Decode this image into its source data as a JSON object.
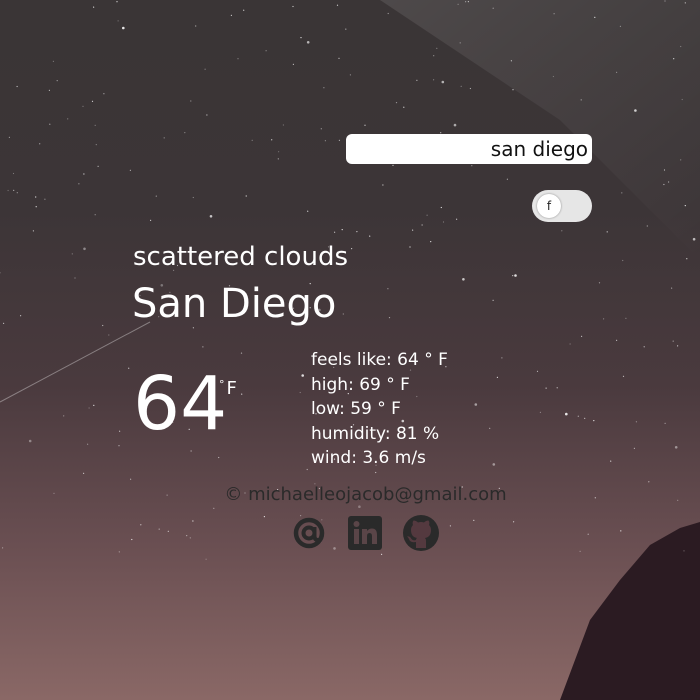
{
  "search": {
    "value": "san diego"
  },
  "unit_toggle": {
    "knob_label": "f",
    "unit": "F"
  },
  "weather": {
    "description": "scattered clouds",
    "city": "San Diego",
    "temperature": "64",
    "temperature_unit": "F",
    "degree_symbol": "°"
  },
  "details": {
    "feels_like": "feels like: 64 ° F",
    "high": "high: 69 ° F",
    "low": "low: 59 ° F",
    "humidity": "humidity: 81 %",
    "wind": "wind: 3.6 m/s"
  },
  "footer": {
    "copyright": "© michaelleojacob@gmail.com",
    "links": [
      "email-icon",
      "linkedin-icon",
      "github-icon"
    ]
  },
  "colors": {
    "text": "#ffffff",
    "footer_text": "#2a2a2a",
    "search_bg": "#ffffff",
    "toggle_bg": "#e6e6e6"
  }
}
